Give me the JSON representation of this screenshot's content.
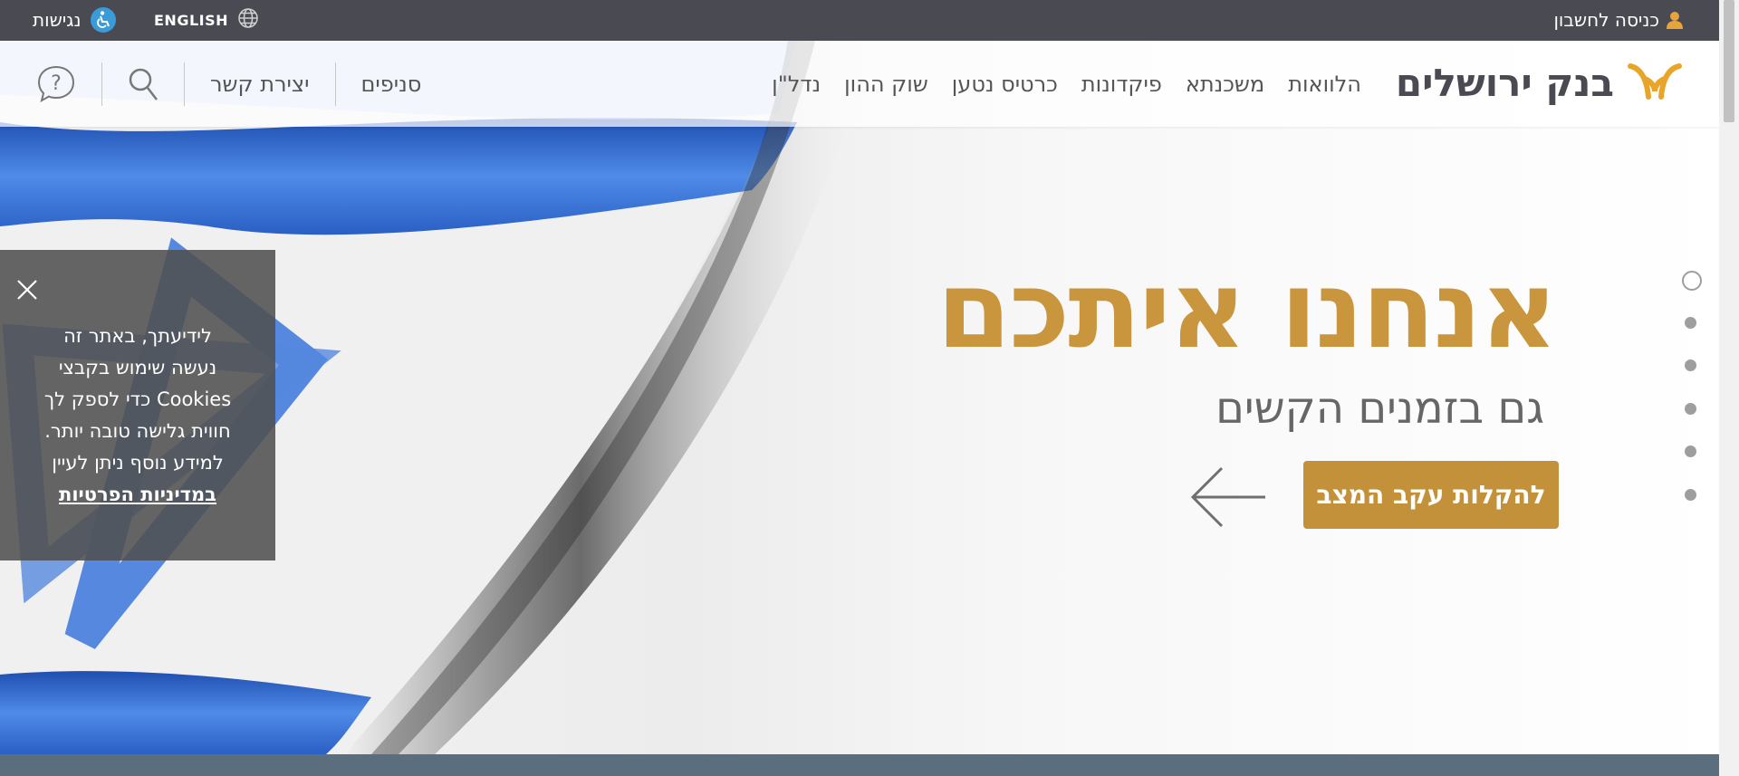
{
  "topbar": {
    "login_label": "כניסה לחשבון",
    "accessibility_label": "נגישות",
    "language_label": "ENGLISH"
  },
  "header": {
    "logo_text": "בנק ירושלים",
    "nav": [
      "הלוואות",
      "משכנתא",
      "פיקדונות",
      "כרטיס נטען",
      "שוק ההון",
      "נדל\"ן"
    ],
    "branches_label": "סניפים",
    "contact_label": "יצירת קשר"
  },
  "hero": {
    "title": "אנחנו איתכם",
    "subtitle": "גם בזמנים הקשים",
    "cta_label": "להקלות עקב המצב"
  },
  "slider": {
    "count": 6,
    "active_index": 0
  },
  "cookie": {
    "line1": "לידיעתך, באתר זה",
    "line2": "נעשה שימוש בקבצי",
    "line3": "Cookies כדי לספק לך",
    "line4": "חווית גלישה טובה יותר.",
    "line5": "למידע נוסף ניתן לעיין",
    "link": "במדיניות הפרטיות"
  },
  "colors": {
    "accent_gold": "#c9963d",
    "topbar_bg": "#4a4b52",
    "flag_blue": "#2f6fd6",
    "accessibility_blue": "#3b9bd8"
  },
  "icons": [
    "user-icon",
    "accessibility-icon",
    "globe-icon",
    "search-icon",
    "chat-help-icon",
    "left-arrow-icon",
    "close-icon",
    "bank-logo-icon"
  ]
}
